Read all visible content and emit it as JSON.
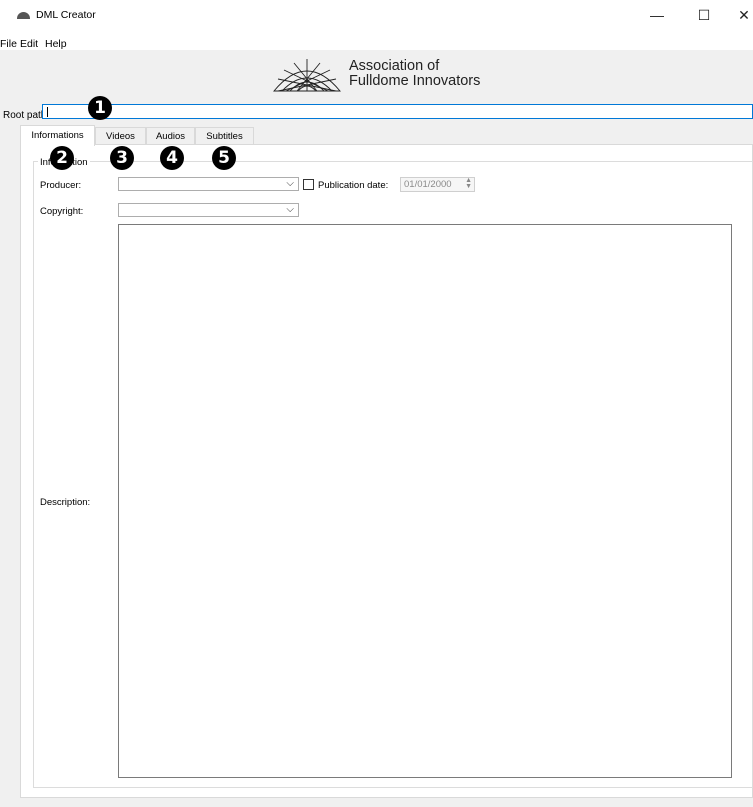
{
  "window": {
    "title": "DML Creator",
    "minimize_glyph": "—",
    "maximize_glyph": "☐",
    "close_glyph": "✕"
  },
  "menu": {
    "file": "File",
    "edit": "Edit",
    "help": "Help"
  },
  "banner": {
    "line1": "Association of",
    "line2": "Fulldome Innovators"
  },
  "root_path": {
    "label": "Root path:",
    "value": ""
  },
  "tabs": [
    {
      "label": "Informations"
    },
    {
      "label": "Videos"
    },
    {
      "label": "Audios"
    },
    {
      "label": "Subtitles"
    }
  ],
  "information": {
    "group_title": "Information",
    "producer_label": "Producer:",
    "producer_value": "",
    "publication_date_label": "Publication date:",
    "publication_date_value": "01/01/2000",
    "copyright_label": "Copyright:",
    "copyright_value": "",
    "description_label": "Description:",
    "description_value": ""
  },
  "callouts": [
    "1",
    "2",
    "3",
    "4",
    "5"
  ],
  "icons": {
    "app": "dome-icon",
    "dropdown": "chevron-down-icon",
    "spinner": "spinner-arrows-icon"
  },
  "colors": {
    "focus_border": "#0078d7",
    "window_bg": "#f0f0f0",
    "callout_bg": "#000000"
  }
}
